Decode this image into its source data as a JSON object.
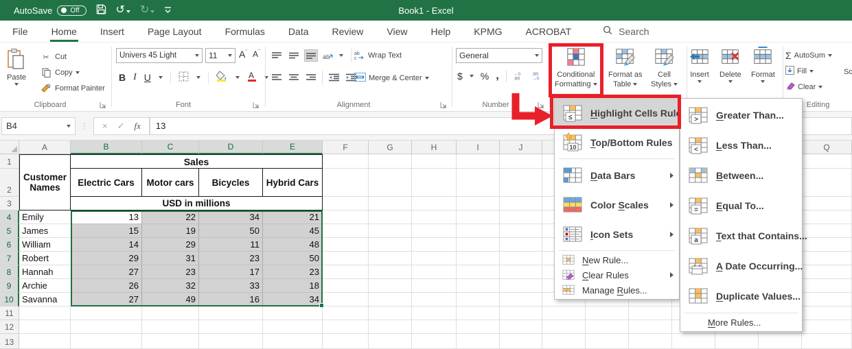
{
  "titlebar": {
    "autosave_label": "AutoSave",
    "autosave_state": "Off",
    "title": "Book1 - Excel"
  },
  "tabs": {
    "items": [
      "File",
      "Home",
      "Insert",
      "Page Layout",
      "Formulas",
      "Data",
      "Review",
      "View",
      "Help",
      "KPMG",
      "ACROBAT"
    ],
    "active": "Home",
    "search_label": "Search"
  },
  "ribbon": {
    "clipboard": {
      "label": "Clipboard",
      "paste": "Paste",
      "cut": "Cut",
      "copy": "Copy",
      "format_painter": "Format Painter"
    },
    "font": {
      "label": "Font",
      "name": "Univers 45 Light",
      "size": "11",
      "bold": "B",
      "italic": "I",
      "underline": "U"
    },
    "alignment": {
      "label": "Alignment",
      "wrap": "Wrap Text",
      "merge": "Merge & Center"
    },
    "number": {
      "label": "Number",
      "format": "General",
      "currency": "$",
      "percent": "%",
      "comma": ","
    },
    "styles": {
      "cf_line1": "Conditional",
      "cf_line2": "Formatting",
      "fat_line1": "Format as",
      "fat_line2": "Table",
      "cs_line1": "Cell",
      "cs_line2": "Styles"
    },
    "cells": {
      "insert": "Insert",
      "delete": "Delete",
      "format": "Format"
    },
    "editing": {
      "label": "Editing",
      "autosum": "AutoSum",
      "fill": "Fill",
      "clear": "Clear",
      "sort_filter": "Sort & Filter"
    }
  },
  "formula_bar": {
    "name_box": "B4",
    "fx": "fx",
    "value": "13"
  },
  "sheet": {
    "columns": [
      "A",
      "B",
      "C",
      "D",
      "E",
      "F",
      "G",
      "H",
      "I",
      "J",
      "",
      "",
      "",
      "",
      "",
      "",
      "Q"
    ],
    "selected_columns": [
      "B",
      "C",
      "D",
      "E"
    ],
    "rows": [
      "1",
      "2",
      "3",
      "4",
      "5",
      "6",
      "7",
      "8",
      "9",
      "10",
      "11",
      "12",
      "13"
    ],
    "selected_rows": [
      4,
      5,
      6,
      7,
      8,
      9,
      10
    ],
    "table": {
      "corner_header": "Customer Names",
      "title": "Sales",
      "col_headers": [
        "Electric Cars",
        "Motor cars",
        "Bicycles",
        "Hybrid Cars"
      ],
      "subtitle": "USD in millions",
      "names": [
        "Emily",
        "James",
        "William",
        "Robert",
        "Hannah",
        "Archie",
        "Savanna"
      ],
      "values": [
        [
          13,
          22,
          34,
          21
        ],
        [
          15,
          19,
          50,
          45
        ],
        [
          14,
          29,
          11,
          48
        ],
        [
          29,
          31,
          23,
          50
        ],
        [
          27,
          23,
          17,
          23
        ],
        [
          26,
          32,
          33,
          18
        ],
        [
          27,
          49,
          16,
          34
        ]
      ],
      "active_cell": "B4",
      "selection": "B4:E10"
    }
  },
  "cf_menu": {
    "items": [
      {
        "label": "Highlight Cells Rules",
        "u": 0,
        "icon": "highlight-cells-rules-icon",
        "arrow": true,
        "highlighted": true,
        "size": "big"
      },
      {
        "label": "Top/Bottom Rules",
        "u": 0,
        "icon": "top-bottom-rules-icon",
        "arrow": true,
        "size": "big"
      },
      {
        "sep": true
      },
      {
        "label": "Data Bars",
        "u": 0,
        "icon": "data-bars-icon",
        "arrow": true,
        "size": "big"
      },
      {
        "label": "Color Scales",
        "u": 6,
        "icon": "color-scales-icon",
        "arrow": true,
        "size": "big"
      },
      {
        "label": "Icon Sets",
        "u": 0,
        "icon": "icon-sets-icon",
        "arrow": true,
        "size": "big"
      },
      {
        "sep": true
      },
      {
        "label": "New Rule...",
        "u": 0,
        "icon": "new-rule-icon",
        "size": "small"
      },
      {
        "label": "Clear Rules",
        "u": 0,
        "icon": "clear-rules-icon",
        "arrow": true,
        "size": "small"
      },
      {
        "label": "Manage Rules...",
        "u": 7,
        "icon": "manage-rules-icon",
        "size": "small"
      }
    ]
  },
  "cf_submenu": {
    "items": [
      {
        "label": "Greater Than...",
        "u": 0,
        "icon": "greater-than-icon"
      },
      {
        "label": "Less Than...",
        "u": 0,
        "icon": "less-than-icon"
      },
      {
        "label": "Between...",
        "u": 0,
        "icon": "between-icon"
      },
      {
        "label": "Equal To...",
        "u": 0,
        "icon": "equal-to-icon"
      },
      {
        "label": "Text that Contains...",
        "u": 0,
        "icon": "text-contains-icon"
      },
      {
        "label": "A Date Occurring...",
        "u": 0,
        "icon": "date-occurring-icon"
      },
      {
        "label": "Duplicate Values...",
        "u": 0,
        "icon": "duplicate-values-icon"
      },
      {
        "sep": true
      },
      {
        "label": "More Rules...",
        "u": 0,
        "icon": null,
        "size": "small"
      }
    ]
  },
  "annotations": {
    "color": "#e8202a",
    "shapes": [
      "box-around-conditional-formatting",
      "box-around-highlight-cells-rules",
      "elbow-arrow-pointing-right"
    ]
  },
  "icons": {
    "save": "floppy-disk",
    "undo": "curved-arrow-left",
    "redo": "curved-arrow-right",
    "search": "magnifier",
    "paste": "clipboard",
    "cut": "scissors",
    "autosum": "sigma",
    "clear": "eraser",
    "menu_grid_icons": "mini-spreadsheet-grid-with-orange-highlight-and-badge"
  }
}
